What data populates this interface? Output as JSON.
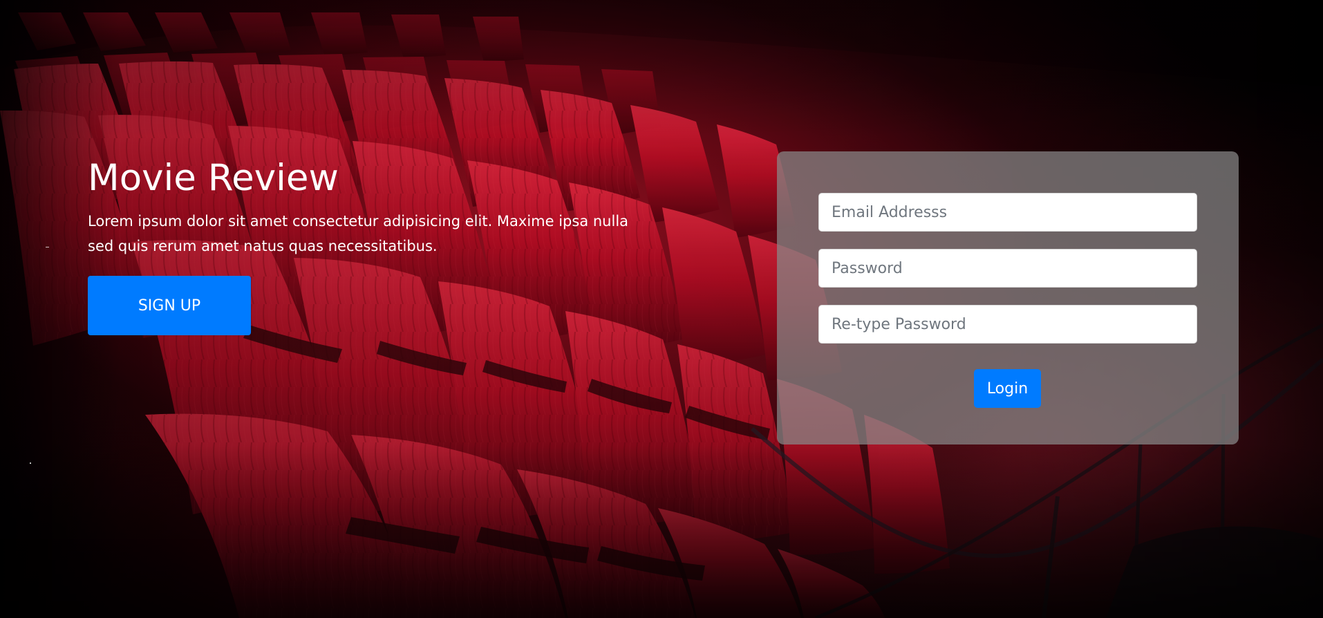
{
  "hero": {
    "title": "Movie Review",
    "description": "Lorem ipsum dolor sit amet consectetur adipisicing elit. Maxime ipsa nulla sed quis rerum amet natus quas necessitatibus.",
    "signup_label": "SIGN UP"
  },
  "login_form": {
    "email_placeholder": "Email Addresss",
    "password_placeholder": "Password",
    "retype_password_placeholder": "Re-type Password",
    "login_label": "Login"
  },
  "colors": {
    "primary_button": "#007bff",
    "card_overlay": "#888888",
    "seat_red": "#b91528",
    "background_dark": "#050203"
  },
  "background": {
    "subject": "theater seats"
  }
}
